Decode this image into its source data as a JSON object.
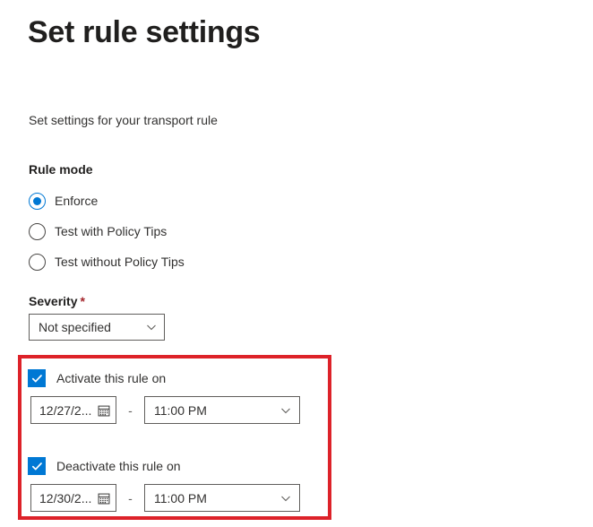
{
  "header": {
    "title": "Set rule settings",
    "subtitle": "Set settings for your transport rule"
  },
  "rule_mode": {
    "label": "Rule mode",
    "options": [
      {
        "label": "Enforce",
        "selected": true
      },
      {
        "label": "Test with Policy Tips",
        "selected": false
      },
      {
        "label": "Test without Policy Tips",
        "selected": false
      }
    ]
  },
  "severity": {
    "label": "Severity",
    "required_marker": "*",
    "value": "Not specified"
  },
  "schedule": {
    "activate": {
      "checkbox_label": "Activate this rule on",
      "checked": true,
      "date": "12/27/2...",
      "separator": "-",
      "time": "11:00 PM"
    },
    "deactivate": {
      "checkbox_label": "Deactivate this rule on",
      "checked": true,
      "date": "12/30/2...",
      "separator": "-",
      "time": "11:00 PM"
    }
  },
  "annotation": {
    "color": "#dd2229"
  },
  "icons": {
    "chevron": "chevron-down-icon",
    "calendar": "calendar-icon",
    "check": "checkmark-icon"
  },
  "colors": {
    "accent": "#0078d4",
    "required": "#a4262c",
    "text": "#323130",
    "border": "#605e5c",
    "annotation_red": "#dd2229"
  }
}
